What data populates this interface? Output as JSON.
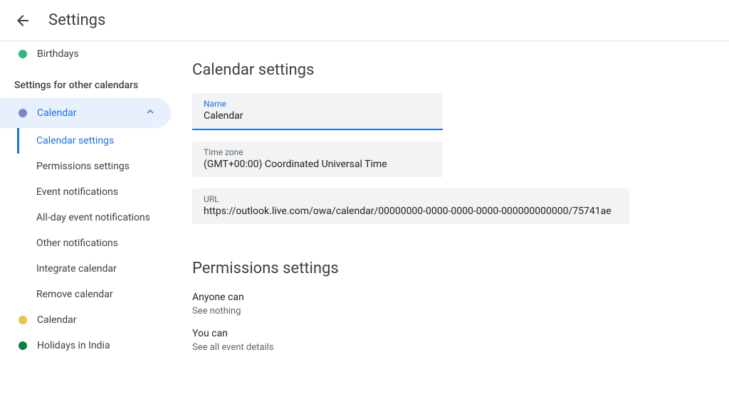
{
  "header": {
    "title": "Settings"
  },
  "sidebar": {
    "top_items": [
      {
        "label": "Birthdays",
        "dot_color": "green"
      }
    ],
    "section_header": "Settings for other calendars",
    "selected_calendar": {
      "label": "Calendar",
      "dot_color": "blue"
    },
    "sub_items": [
      {
        "label": "Calendar settings",
        "active": true
      },
      {
        "label": "Permissions settings",
        "active": false
      },
      {
        "label": "Event notifications",
        "active": false
      },
      {
        "label": "All-day event notifications",
        "active": false
      },
      {
        "label": "Other notifications",
        "active": false
      },
      {
        "label": "Integrate calendar",
        "active": false
      },
      {
        "label": "Remove calendar",
        "active": false
      }
    ],
    "bottom_items": [
      {
        "label": "Calendar",
        "dot_color": "yellow"
      },
      {
        "label": "Holidays in India",
        "dot_color": "dgreen"
      }
    ]
  },
  "main": {
    "calendar_settings": {
      "title": "Calendar settings",
      "name": {
        "label": "Name",
        "value": "Calendar"
      },
      "timezone": {
        "label": "Time zone",
        "value": "(GMT+00:00) Coordinated Universal Time"
      },
      "url": {
        "label": "URL",
        "value": "https://outlook.live.com/owa/calendar/00000000-0000-0000-0000-000000000000/75741ae"
      }
    },
    "permissions": {
      "title": "Permissions settings",
      "entries": [
        {
          "who": "Anyone can",
          "what": "See nothing"
        },
        {
          "who": "You can",
          "what": "See all event details"
        }
      ]
    }
  }
}
